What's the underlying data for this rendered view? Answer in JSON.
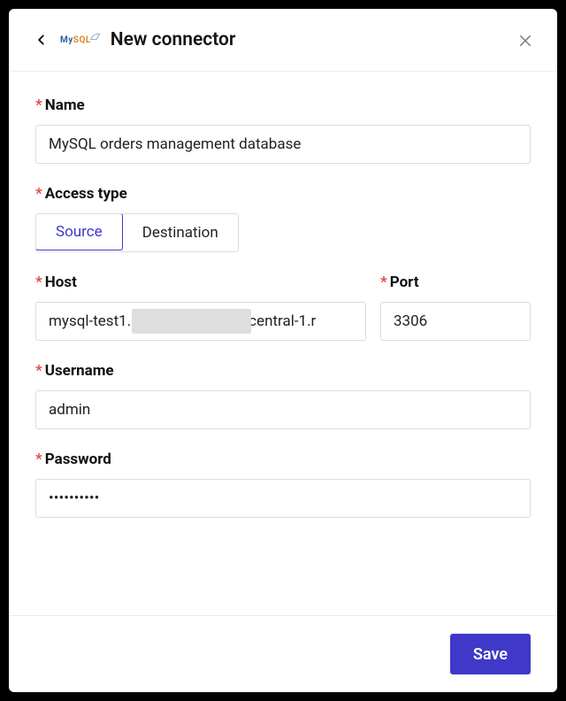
{
  "header": {
    "title": "New connector",
    "logo_text_1": "My",
    "logo_text_2": "SQL"
  },
  "form": {
    "name": {
      "label": "Name",
      "value": "MySQL orders management database"
    },
    "access_type": {
      "label": "Access type",
      "options": [
        "Source",
        "Destination"
      ],
      "selected": "Source"
    },
    "host": {
      "label": "Host",
      "value": "mysql-test1.                         .eu-central-1.r"
    },
    "port": {
      "label": "Port",
      "value": "3306"
    },
    "username": {
      "label": "Username",
      "value": "admin"
    },
    "password": {
      "label": "Password",
      "value": "••••••••••"
    }
  },
  "footer": {
    "save_label": "Save"
  },
  "required_marker": "*"
}
